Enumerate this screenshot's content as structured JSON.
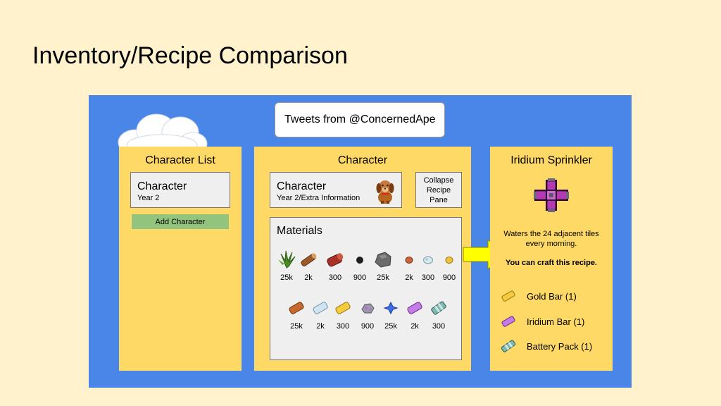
{
  "slide": {
    "title": "Inventory/Recipe Comparison"
  },
  "tweets": {
    "label": "Tweets from @ConcernedApe"
  },
  "character_list": {
    "title": "Character List",
    "card": {
      "name": "Character",
      "sub": "Year 2"
    },
    "add_button": "Add Character"
  },
  "character": {
    "title": "Character",
    "card": {
      "name": "Character",
      "sub": "Year 2/Extra Information",
      "portrait_icon": "dog-icon"
    },
    "collapse_button": {
      "line1": "Collapse",
      "line2": "Recipe",
      "line3": "Pane"
    }
  },
  "materials": {
    "title": "Materials",
    "row1": [
      {
        "icon": "fiber-icon",
        "qty": "25k"
      },
      {
        "icon": "wood-icon",
        "qty": "2k"
      },
      {
        "icon": "hardwood-icon",
        "qty": "300"
      },
      {
        "icon": "coal-icon",
        "qty": "900"
      },
      {
        "icon": "stone-icon",
        "qty": "25k"
      },
      {
        "icon": "copper-ore-icon",
        "qty": "2k"
      },
      {
        "icon": "iron-ore-icon",
        "qty": "300"
      },
      {
        "icon": "gold-ore-icon",
        "qty": "900"
      }
    ],
    "row2": [
      {
        "icon": "copper-bar-icon",
        "qty": "25k"
      },
      {
        "icon": "iron-bar-icon",
        "qty": "2k"
      },
      {
        "icon": "gold-bar-icon",
        "qty": "300"
      },
      {
        "icon": "iridium-ore-icon",
        "qty": "900"
      },
      {
        "icon": "refined-quartz-icon",
        "qty": "25k"
      },
      {
        "icon": "iridium-bar-icon",
        "qty": "2k"
      },
      {
        "icon": "battery-pack-icon",
        "qty": "300"
      }
    ]
  },
  "recipe": {
    "title": "Iridium Sprinkler",
    "description": "Waters the 24 adjacent tiles every morning.",
    "can_craft": "You can craft this recipe.",
    "ingredients": [
      {
        "icon": "gold-bar-icon",
        "label": "Gold Bar (1)"
      },
      {
        "icon": "iridium-bar-icon",
        "label": "Iridium Bar (1)"
      },
      {
        "icon": "battery-pack-icon",
        "label": "Battery Pack (1)"
      }
    ]
  },
  "colors": {
    "background": "#fff2cc",
    "frame": "#4a86e8",
    "panel": "#ffd966",
    "card": "#efefef",
    "add_button": "#93c47d",
    "arrow": "#ffff00"
  }
}
